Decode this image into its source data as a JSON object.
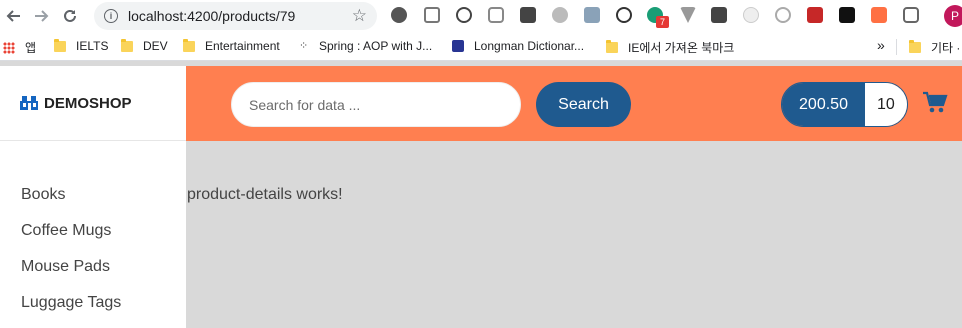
{
  "browser": {
    "url": "localhost:4200/products/79",
    "badge_count": "7",
    "profile_initial": "P",
    "bookmarks": [
      {
        "label": "앱"
      },
      {
        "label": "IELTS"
      },
      {
        "label": "DEV"
      },
      {
        "label": "Entertainment"
      },
      {
        "label": "Spring : AOP with J..."
      },
      {
        "label": "Longman Dictionar..."
      },
      {
        "label": "IE에서 가져온 북마크"
      },
      {
        "label": "기타 ·"
      }
    ],
    "overflow": "»"
  },
  "header": {
    "logo_text": "DEMOSHOP",
    "search_placeholder": "Search for data ...",
    "search_button": "Search",
    "cart_total": "200.50",
    "cart_count": "10"
  },
  "sidebar": {
    "categories": [
      {
        "label": "Books"
      },
      {
        "label": "Coffee Mugs"
      },
      {
        "label": "Mouse Pads"
      },
      {
        "label": "Luggage Tags"
      }
    ]
  },
  "main": {
    "message": "product-details works!"
  },
  "colors": {
    "header_bg": "#ff7f50",
    "primary": "#1f5a8f",
    "page_bg": "#d9d9d9"
  },
  "icons": [
    "back-icon",
    "forward-icon",
    "reload-icon",
    "info-icon",
    "star-icon",
    "apps-icon",
    "folder-icon",
    "store-icon",
    "cart-icon"
  ]
}
